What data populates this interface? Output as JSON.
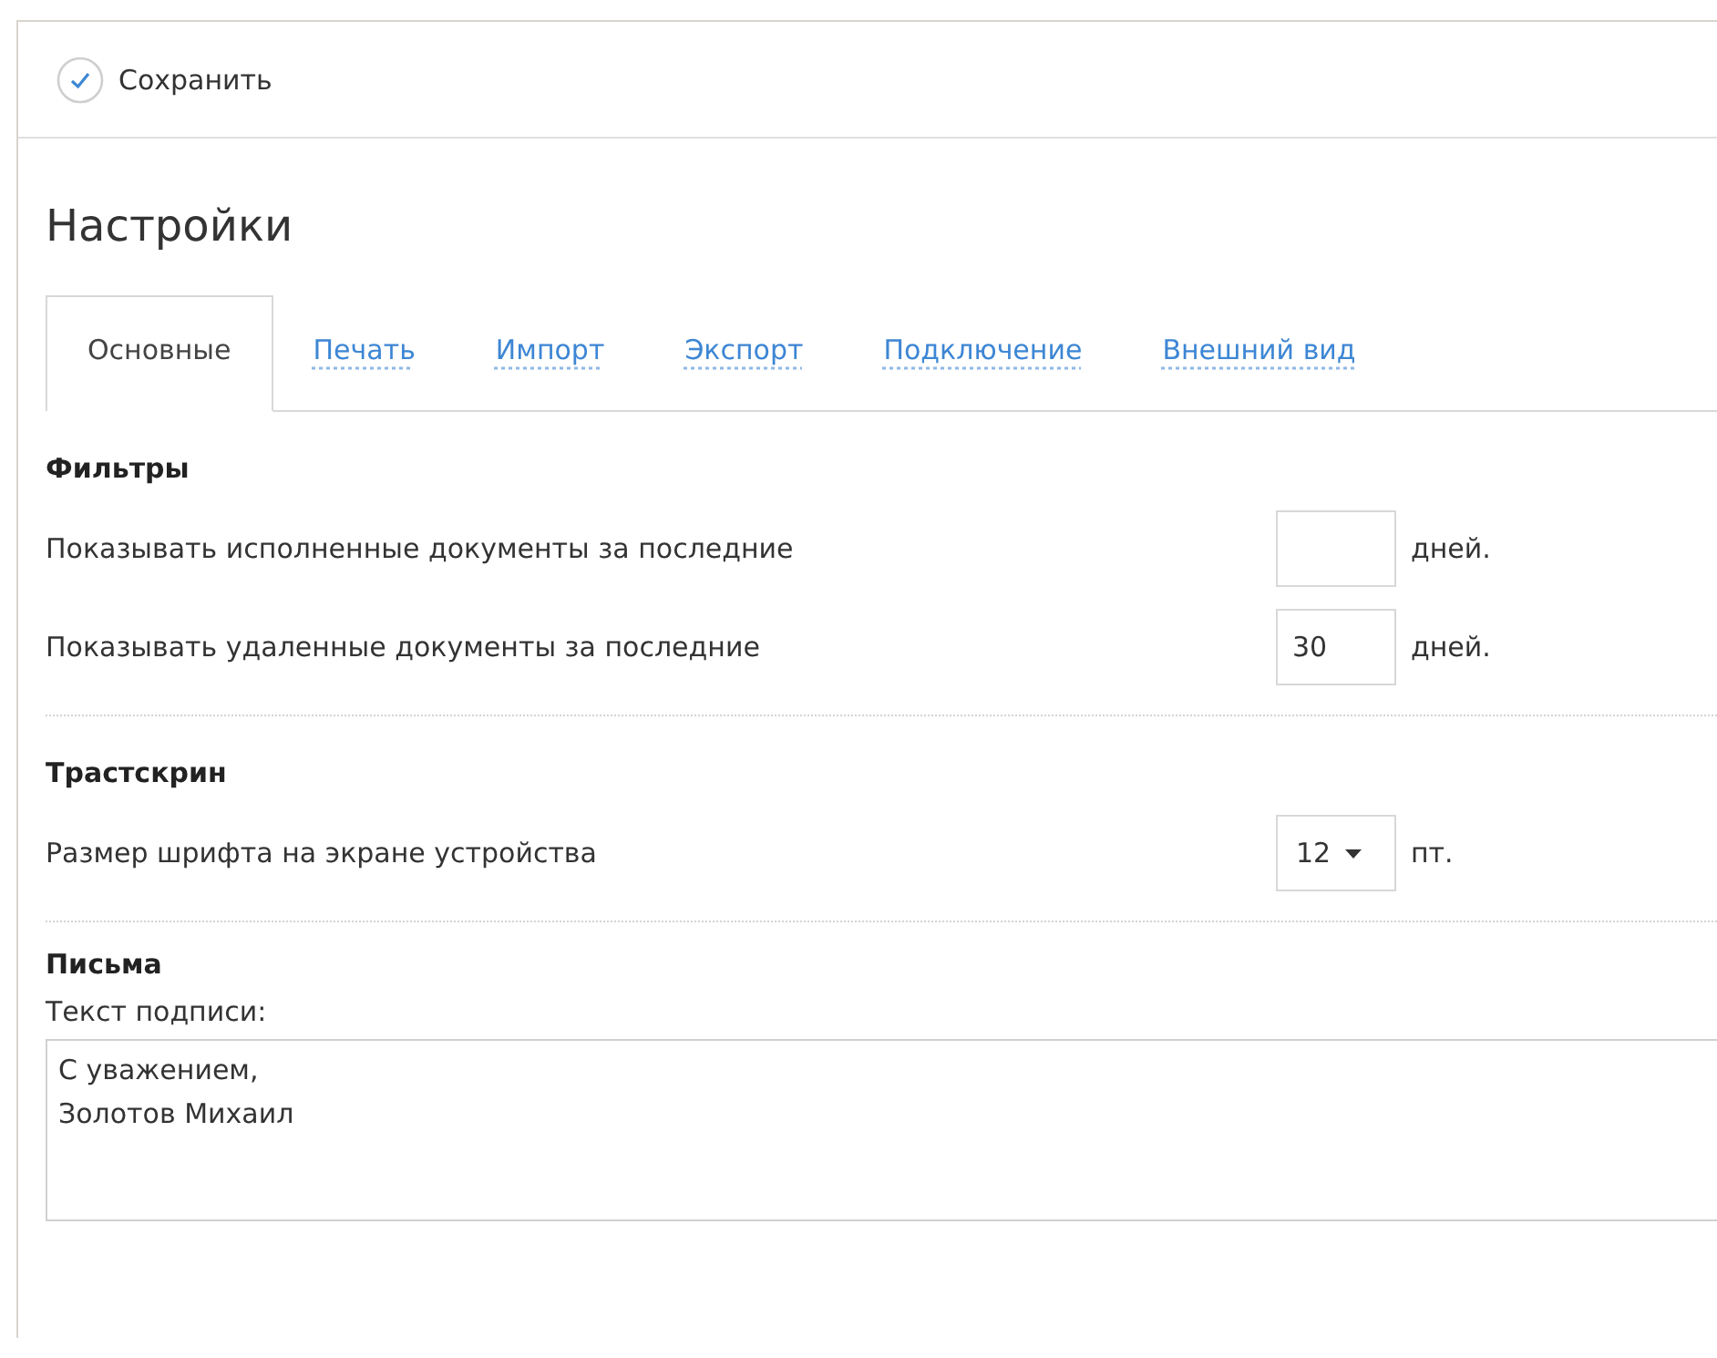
{
  "toolbar": {
    "save_button": "Сохранить"
  },
  "title": "Настройки",
  "tabs": [
    {
      "label": "Основные",
      "selected": true
    },
    {
      "label": "Печать",
      "selected": false
    },
    {
      "label": "Импорт",
      "selected": false
    },
    {
      "label": "Экспорт",
      "selected": false
    },
    {
      "label": "Подключение",
      "selected": false
    },
    {
      "label": "Внешний вид",
      "selected": false
    }
  ],
  "sections": [
    {
      "heading": "Фильтры",
      "rows": [
        {
          "kind": "number",
          "label": "Показывать исполненные документы за последние",
          "value": "",
          "unit": "дней."
        },
        {
          "kind": "number",
          "label": "Показывать удаленные документы за последние",
          "value": "30",
          "unit": "дней."
        }
      ]
    },
    {
      "heading": "Трастскрин",
      "rows": [
        {
          "kind": "select",
          "label": "Размер шрифта на экране устройства",
          "value": "12",
          "unit": "пт."
        }
      ]
    },
    {
      "heading": "Письма",
      "rows": [
        {
          "kind": "textarea",
          "label": "Текст подписи:",
          "value": "С уважением,\nЗолотов Михаил"
        }
      ]
    }
  ]
}
